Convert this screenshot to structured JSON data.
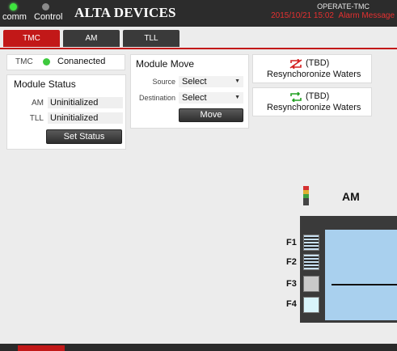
{
  "header": {
    "comm_label": "comm",
    "control_label": "Control",
    "brand": "ALTA DEVICES",
    "mode": "OPERATE-TMC",
    "datetime": "2015/10/21  15:02",
    "alarm": "Alarm Message"
  },
  "tabs": [
    {
      "label": "TMC",
      "active": true
    },
    {
      "label": "AM",
      "active": false
    },
    {
      "label": "TLL",
      "active": false
    }
  ],
  "tmc": {
    "label": "TMC",
    "status": "Conanected",
    "led_color": "#3ec93e"
  },
  "module_status": {
    "title": "Module Status",
    "rows": [
      {
        "label": "AM",
        "value": "Uninitialized"
      },
      {
        "label": "TLL",
        "value": "Uninitialized"
      }
    ],
    "set_button": "Set Status"
  },
  "module_move": {
    "title": "Module Move",
    "source_label": "Source",
    "source_value": "Select",
    "destination_label": "Destination",
    "destination_value": "Select",
    "move_button": "Move"
  },
  "resync": [
    {
      "tbd": "(TBD)",
      "label": "Resynchoronize Waters",
      "icon": "sync-disabled-icon",
      "color": "#d42020"
    },
    {
      "tbd": "(TBD)",
      "label": "Resynchoronize Waters",
      "icon": "sync-icon",
      "color": "#22a022"
    }
  ],
  "am_module": {
    "title": "AM",
    "slots": [
      {
        "label": "F1",
        "state": "striped"
      },
      {
        "label": "F2",
        "state": "striped"
      },
      {
        "label": "F3",
        "state": "gray"
      },
      {
        "label": "F4",
        "state": "light"
      }
    ]
  }
}
